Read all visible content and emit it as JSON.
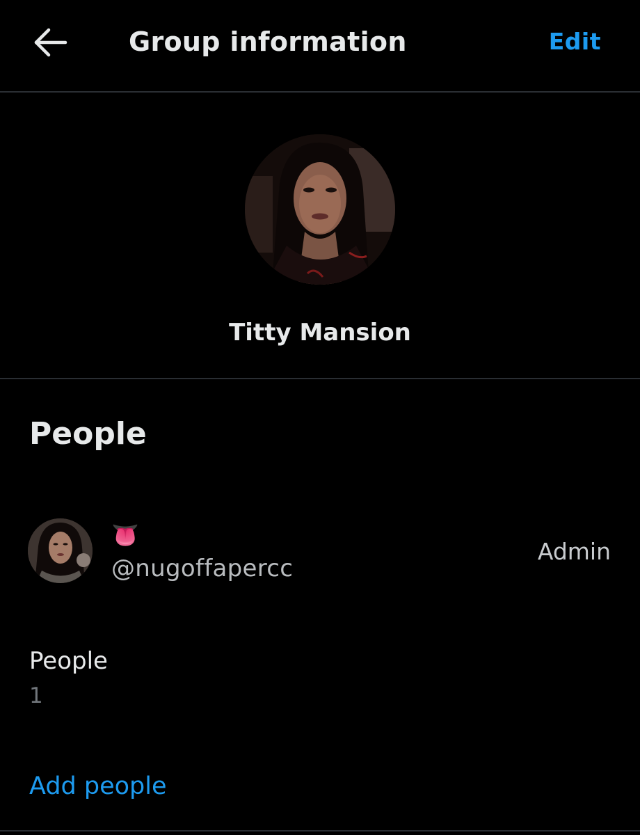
{
  "header": {
    "back_icon": "arrow-left-icon",
    "title": "Group information",
    "edit_label": "Edit"
  },
  "group": {
    "avatar": "group-avatar-photo",
    "name": "Titty Mansion"
  },
  "people_section": {
    "heading": "People",
    "members": [
      {
        "display_name": "👅",
        "handle": "@nugoffapercc",
        "role": "Admin",
        "avatar": "member-avatar-photo"
      }
    ],
    "count_label": "People",
    "count_value": "1",
    "add_label": "Add people"
  },
  "colors": {
    "background": "#000000",
    "accent": "#1d9bf0",
    "primary_text": "#e7e9ea",
    "secondary_text": "#71767b",
    "divider": "#2a2e33"
  }
}
